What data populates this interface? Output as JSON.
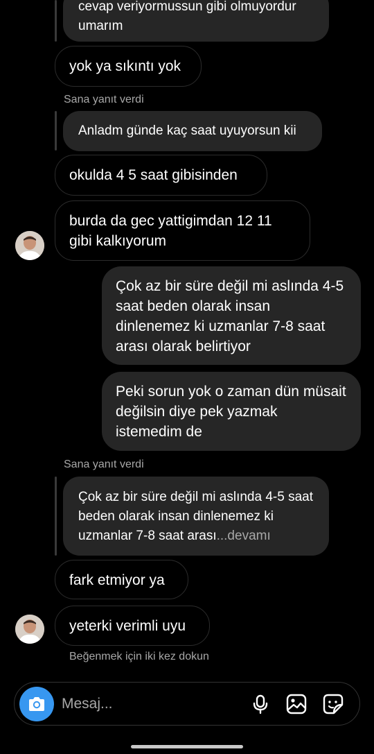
{
  "thread": {
    "q1_text": "cevap veriyormussun gibi olmuyordur umarım",
    "m1_text": "yok ya sıkıntı yok",
    "replied_label_1": "Sana yanıt verdi",
    "q2_text": "Anladm günde kaç saat uyuyorsun kii",
    "m2_text": "okulda 4 5 saat gibisinden",
    "m3_text": "burda da gec yattigimdan 12 11 gibi kalkıyorum",
    "o1_text": "Çok az bir süre değil mi aslında 4-5 saat beden olarak insan dinlenemez ki uzmanlar 7-8 saat arası olarak belirtiyor",
    "o2_text": "Peki sorun yok o zaman dün müsait değilsin diye pek yazmak istemedim de",
    "replied_label_2": "Sana yanıt verdi",
    "q3_text": "Çok az bir süre değil mi aslında 4-5 saat beden olarak insan dinlenemez ki uzmanlar 7-8 saat arası",
    "q3_more": "...devamı",
    "m4_text": "fark etmiyor ya",
    "m5_text": "yeterki verimli uyu",
    "like_hint": "Beğenmek için iki kez dokun"
  },
  "composer": {
    "placeholder": "Mesaj..."
  },
  "icons": {
    "camera": "camera-icon",
    "mic": "microphone-icon",
    "gallery": "gallery-icon",
    "sticker": "sticker-icon"
  },
  "colors": {
    "accent": "#3797f0",
    "bubble_out": "#262626",
    "secondary_text": "#a8a8a8"
  }
}
